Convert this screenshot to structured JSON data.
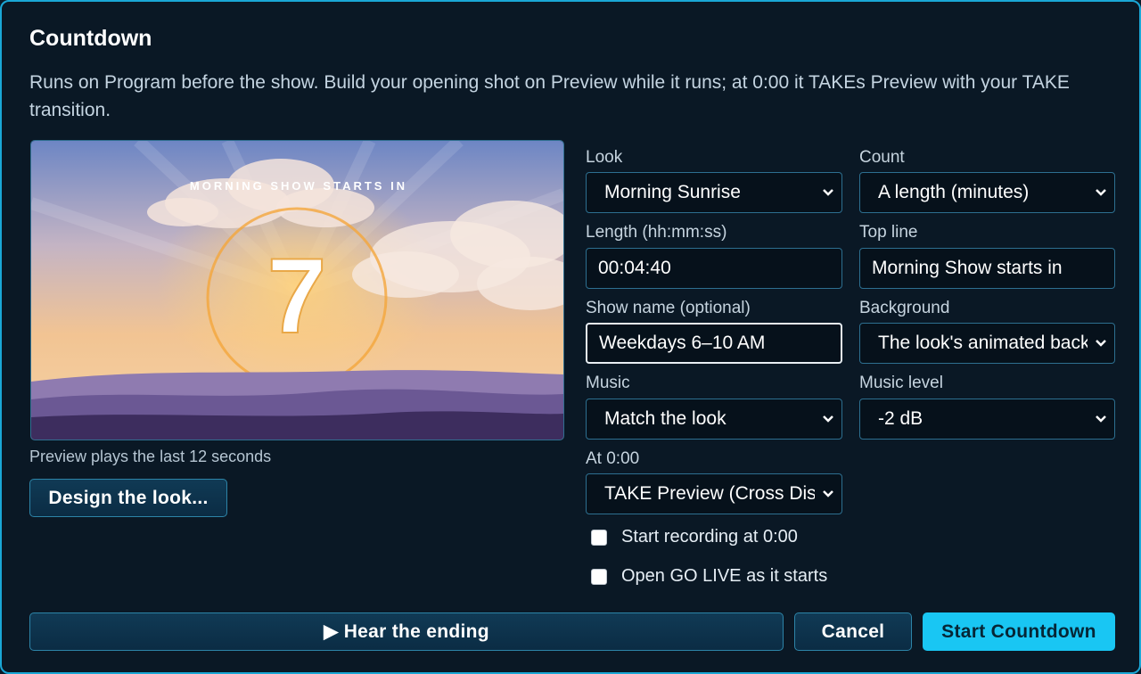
{
  "dialog": {
    "title": "Countdown",
    "description": "Runs on Program before the show. Build your opening shot on Preview while it runs; at 0:00 it TAKEs Preview with your TAKE transition."
  },
  "preview": {
    "top_line": "MORNING SHOW STARTS IN",
    "number": "7",
    "note": "Preview plays the last 12 seconds"
  },
  "buttons": {
    "design": "Design the look...",
    "hear": "▶ Hear the ending",
    "cancel": "Cancel",
    "start": "Start Countdown"
  },
  "form": {
    "look": {
      "label": "Look",
      "value": "Morning Sunrise"
    },
    "count": {
      "label": "Count",
      "value": "A length (minutes)"
    },
    "length": {
      "label": "Length (hh:mm:ss)",
      "value": "00:04:40"
    },
    "top_line": {
      "label": "Top line",
      "value": "Morning Show starts in"
    },
    "show_name": {
      "label": "Show name (optional)",
      "value": "Weekdays 6–10 AM"
    },
    "background": {
      "label": "Background",
      "value": "The look's animated background"
    },
    "music": {
      "label": "Music",
      "value": "Match the look"
    },
    "music_level": {
      "label": "Music level",
      "value": "-2 dB"
    },
    "at_zero": {
      "label": "At 0:00",
      "value": "TAKE Preview (Cross Dissolve)"
    },
    "start_recording": {
      "label": "Start recording at 0:00",
      "checked": false
    },
    "open_go_live": {
      "label": "Open GO LIVE as it starts",
      "checked": false
    }
  },
  "colors": {
    "accent": "#19c6f3",
    "border": "#1aa7d6",
    "background": "#0a1825"
  }
}
